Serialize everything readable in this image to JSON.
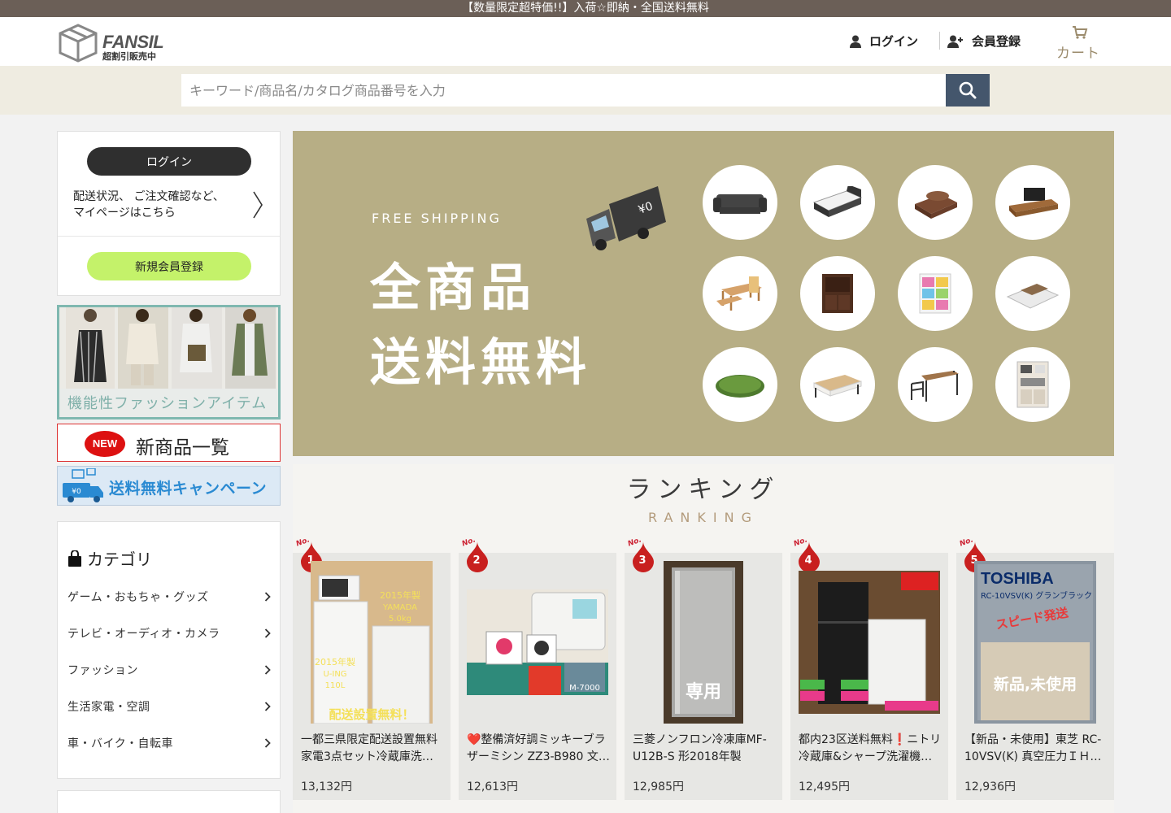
{
  "topbar": {
    "announcement": "【数量限定超特価!!】入荷☆即納・全国送料無料"
  },
  "header": {
    "logo_name": "FANSIL",
    "logo_sub": "超割引販売中",
    "login_label": "ログイン",
    "register_label": "会員登録",
    "cart_label": "カート"
  },
  "search": {
    "placeholder": "キーワード/商品名/カタログ商品番号を入力"
  },
  "sidebar": {
    "login_button": "ログイン",
    "login_desc_1": "配送状況、 ご注文確認など、",
    "login_desc_2": "マイページはこちら",
    "register_button": "新規会員登録",
    "banner_fashion": "機能性ファッションアイテム",
    "banner_new_badge": "NEW",
    "banner_new": "新商品一覧",
    "banner_ship": "送料無料キャンペーン",
    "category_title": "カテゴリ",
    "categories": [
      {
        "label": "ゲーム・おもちゃ・グッズ"
      },
      {
        "label": "テレビ・オーディオ・カメラ"
      },
      {
        "label": "ファッション"
      },
      {
        "label": "生活家電・空調"
      },
      {
        "label": "車・バイク・自転車"
      }
    ]
  },
  "hero": {
    "free_shipping": "FREE SHIPPING",
    "line1": "全商品",
    "line2": "送料無料",
    "truck_label": "¥0"
  },
  "ranking": {
    "title": "ランキング",
    "subtitle": "RANKING",
    "rank_prefix": "No.",
    "items": [
      {
        "rank": "1",
        "name": "一都三県限定配送設置無料家電3点セット冷蔵庫洗…",
        "price": "13,132円",
        "img_text": "配送設置無料！"
      },
      {
        "rank": "2",
        "name": "❤️整備済好調ミッキーブラザーミシン ZZ3-B980 文…",
        "price": "12,613円",
        "img_text": ""
      },
      {
        "rank": "3",
        "name": "三菱ノンフロン冷凍庫MF-U12B-S 形2018年製",
        "price": "12,985円",
        "img_text": "専用"
      },
      {
        "rank": "4",
        "name": "都内23区送料無料❗ニトリ冷蔵庫&シャープ洗濯機…",
        "price": "12,495円",
        "img_text": ""
      },
      {
        "rank": "5",
        "name": "【新品・未使用】東芝 RC-10VSV(K) 真空圧力ＩＨ…",
        "price": "12,936円",
        "img_text": "新品,未使用",
        "img_brand": "TOSHIBA",
        "img_model": "RC-10VSV(K) グランブラック",
        "img_tag": "スピード発送"
      }
    ]
  },
  "colors": {
    "topbar": "#6b5f57",
    "search_button": "#44566c",
    "hero_bg": "#b7ae85",
    "register_button": "#c4f26a",
    "rank_badge": "#c8201f"
  }
}
